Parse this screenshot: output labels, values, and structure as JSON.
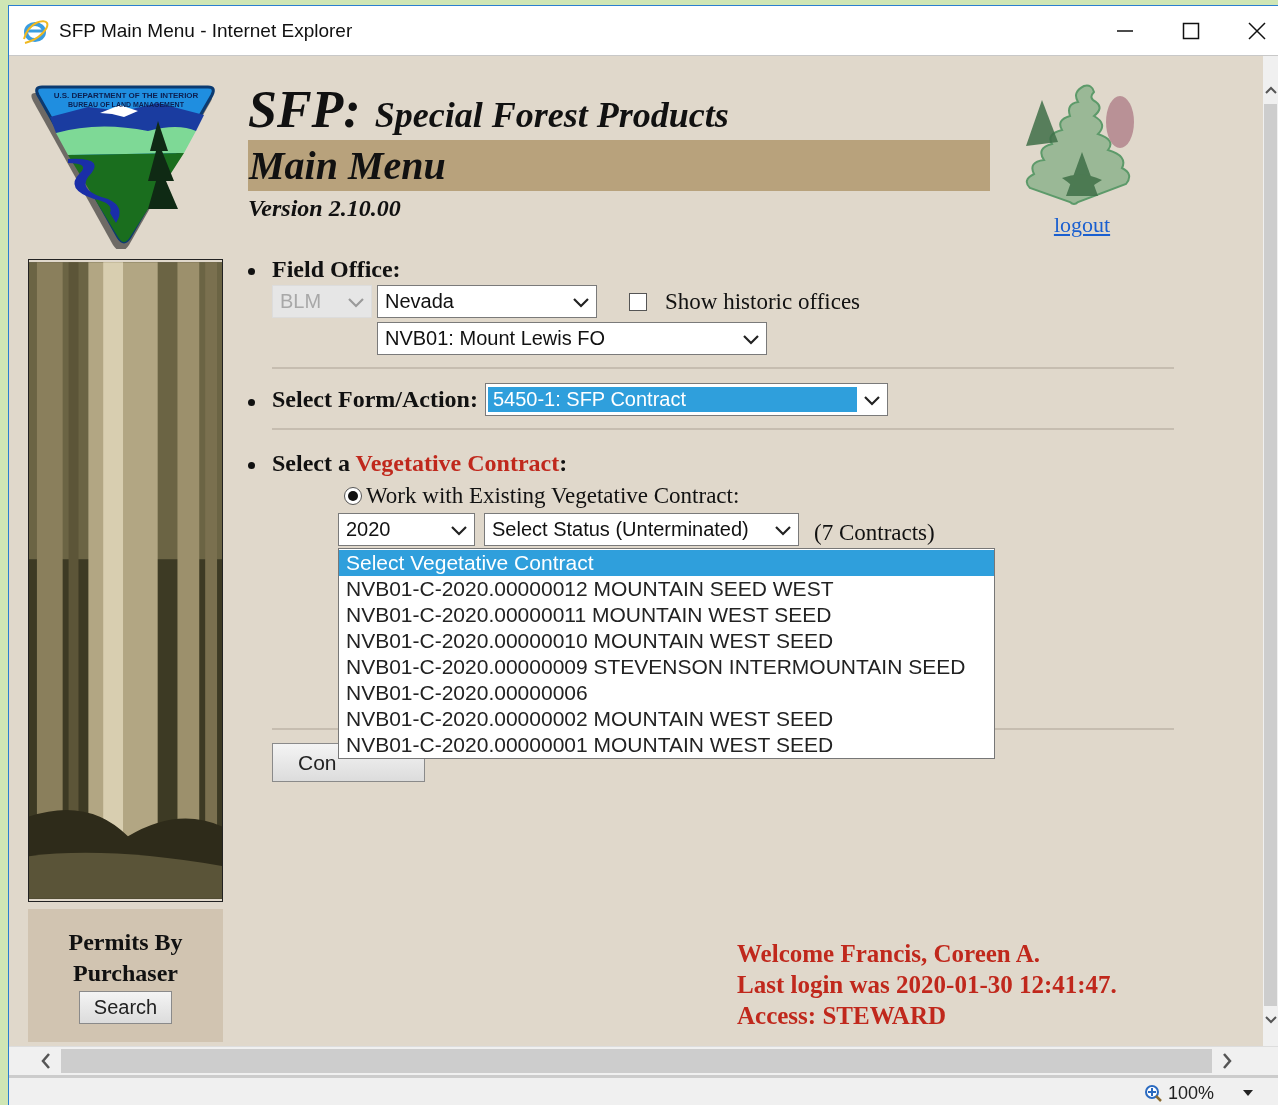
{
  "window": {
    "title": "SFP Main Menu - Internet Explorer"
  },
  "logo": {
    "lines": [
      "U.S. DEPARTMENT OF THE INTERIOR",
      "BUREAU OF LAND MANAGEMENT"
    ]
  },
  "header": {
    "app": "SFP:",
    "subtitle": "Special Forest Products",
    "section": "Main Menu",
    "version": "Version 2.10.00",
    "logout": "logout"
  },
  "sidebar": {
    "permits_title": "Permits By Purchaser",
    "search_button": "Search"
  },
  "field_office": {
    "label": "Field Office:",
    "agency": {
      "value": "BLM",
      "disabled": true
    },
    "state": {
      "value": "Nevada",
      "disabled": false
    },
    "office": {
      "value": "NVB01: Mount Lewis FO",
      "disabled": false
    },
    "show_historic": {
      "label": "Show historic offices",
      "checked": false
    }
  },
  "form_action": {
    "label": "Select Form/Action:",
    "value": "5450-1: SFP Contract",
    "focused": true
  },
  "contract": {
    "label_prefix": "Select a",
    "label_highlight": "Vegetative Contract",
    "label_suffix": ":",
    "mode": {
      "label": "Work with Existing Vegetative Contract:",
      "selected": true
    },
    "year": "2020",
    "status": "Select Status (Unterminated)",
    "count": "(7 Contracts)",
    "options": [
      {
        "label": "Select Vegetative Contract",
        "selected": true
      },
      {
        "label": "NVB01-C-2020.00000012 MOUNTAIN SEED WEST",
        "selected": false
      },
      {
        "label": "NVB01-C-2020.00000011 MOUNTAIN WEST SEED",
        "selected": false
      },
      {
        "label": "NVB01-C-2020.00000010 MOUNTAIN WEST SEED",
        "selected": false
      },
      {
        "label": "NVB01-C-2020.00000009 STEVENSON INTERMOUNTAIN SEED",
        "selected": false
      },
      {
        "label": "NVB01-C-2020.00000006",
        "selected": false
      },
      {
        "label": "NVB01-C-2020.00000002 MOUNTAIN WEST SEED",
        "selected": false
      },
      {
        "label": "NVB01-C-2020.00000001 MOUNTAIN WEST SEED",
        "selected": false
      }
    ]
  },
  "continue_button": "Con",
  "welcome": [
    "Welcome Francis, Coreen A.",
    "Last login was 2020-01-30 12:41:47.",
    "Access: STEWARD"
  ],
  "status_bar": {
    "zoom": "100%"
  }
}
